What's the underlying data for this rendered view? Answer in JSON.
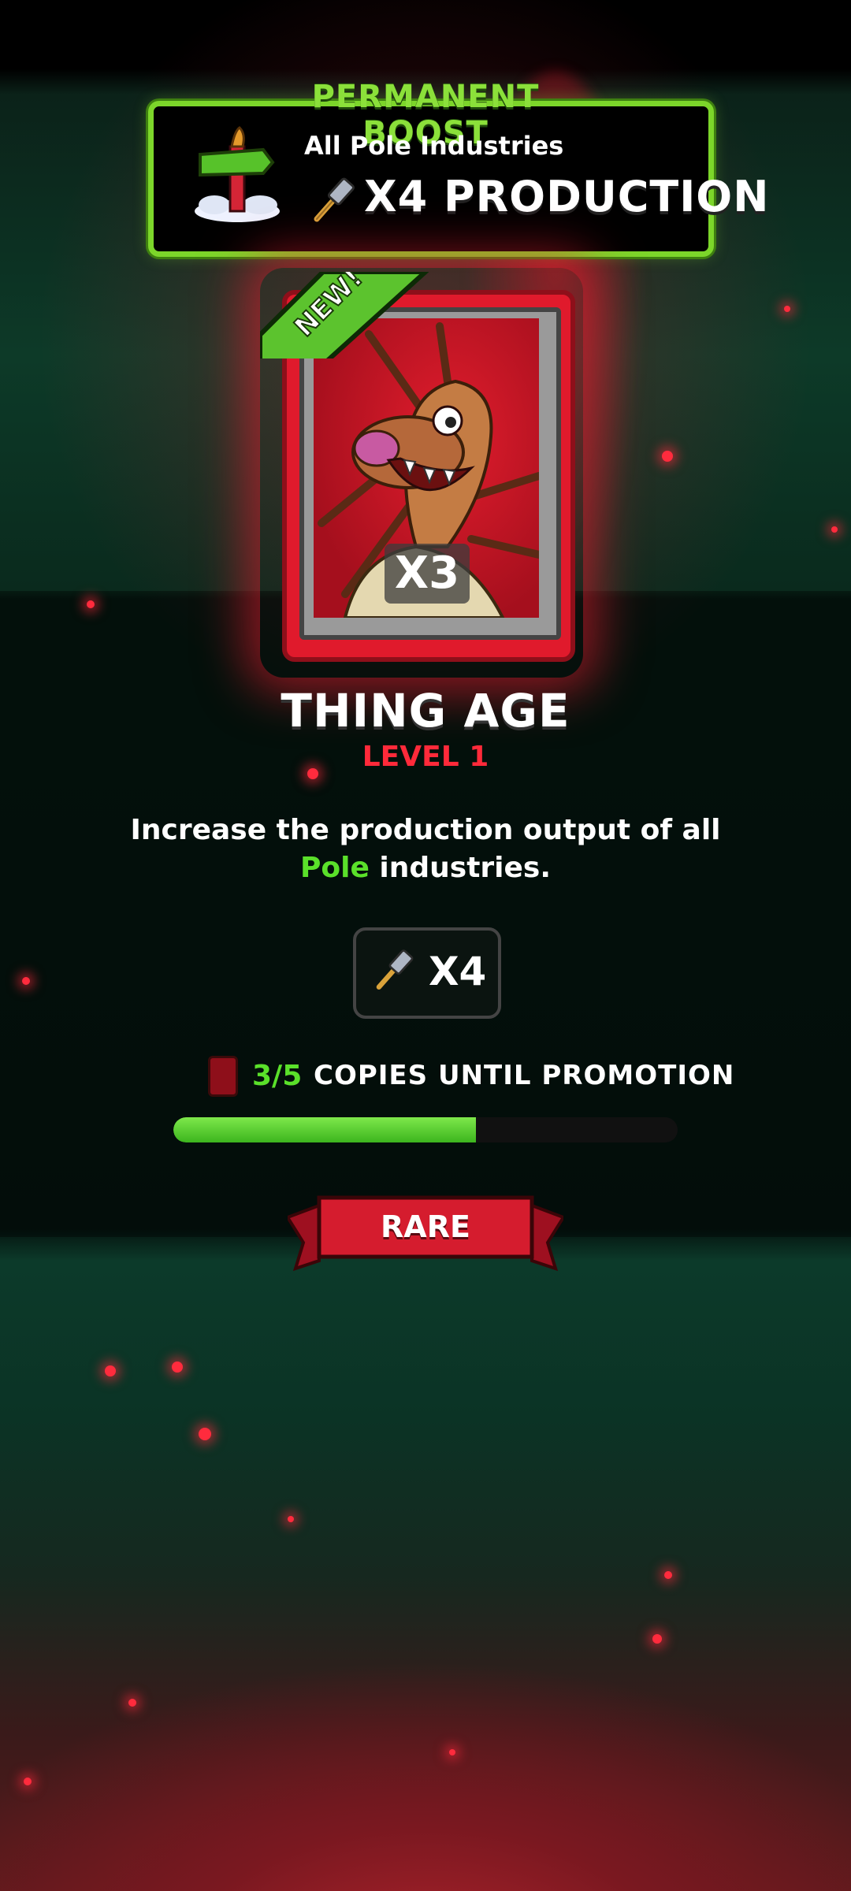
{
  "boost": {
    "title": "PERMANENT BOOST",
    "subtitle": "All Pole Industries",
    "multiplier_label": "X4 PRODUCTION",
    "icon": "signpost-icon",
    "multiplier_icon": "hammer-icon"
  },
  "card": {
    "badge": "NEW!",
    "copies_badge": "X3",
    "name": "THING AGE",
    "level": "LEVEL 1",
    "colors": {
      "frame": "#e01a2c",
      "badge": "#5cc32e"
    }
  },
  "description": {
    "prefix": "Increase the production output of all ",
    "highlight": "Pole",
    "suffix": " industries."
  },
  "effect": {
    "icon": "hammer-icon",
    "multiplier": "X4"
  },
  "promotion": {
    "count": "3/5",
    "label": "COPIES UNTIL PROMOTION",
    "progress": 0.6
  },
  "rarity": {
    "label": "RARE",
    "color": "#d51c2e"
  }
}
